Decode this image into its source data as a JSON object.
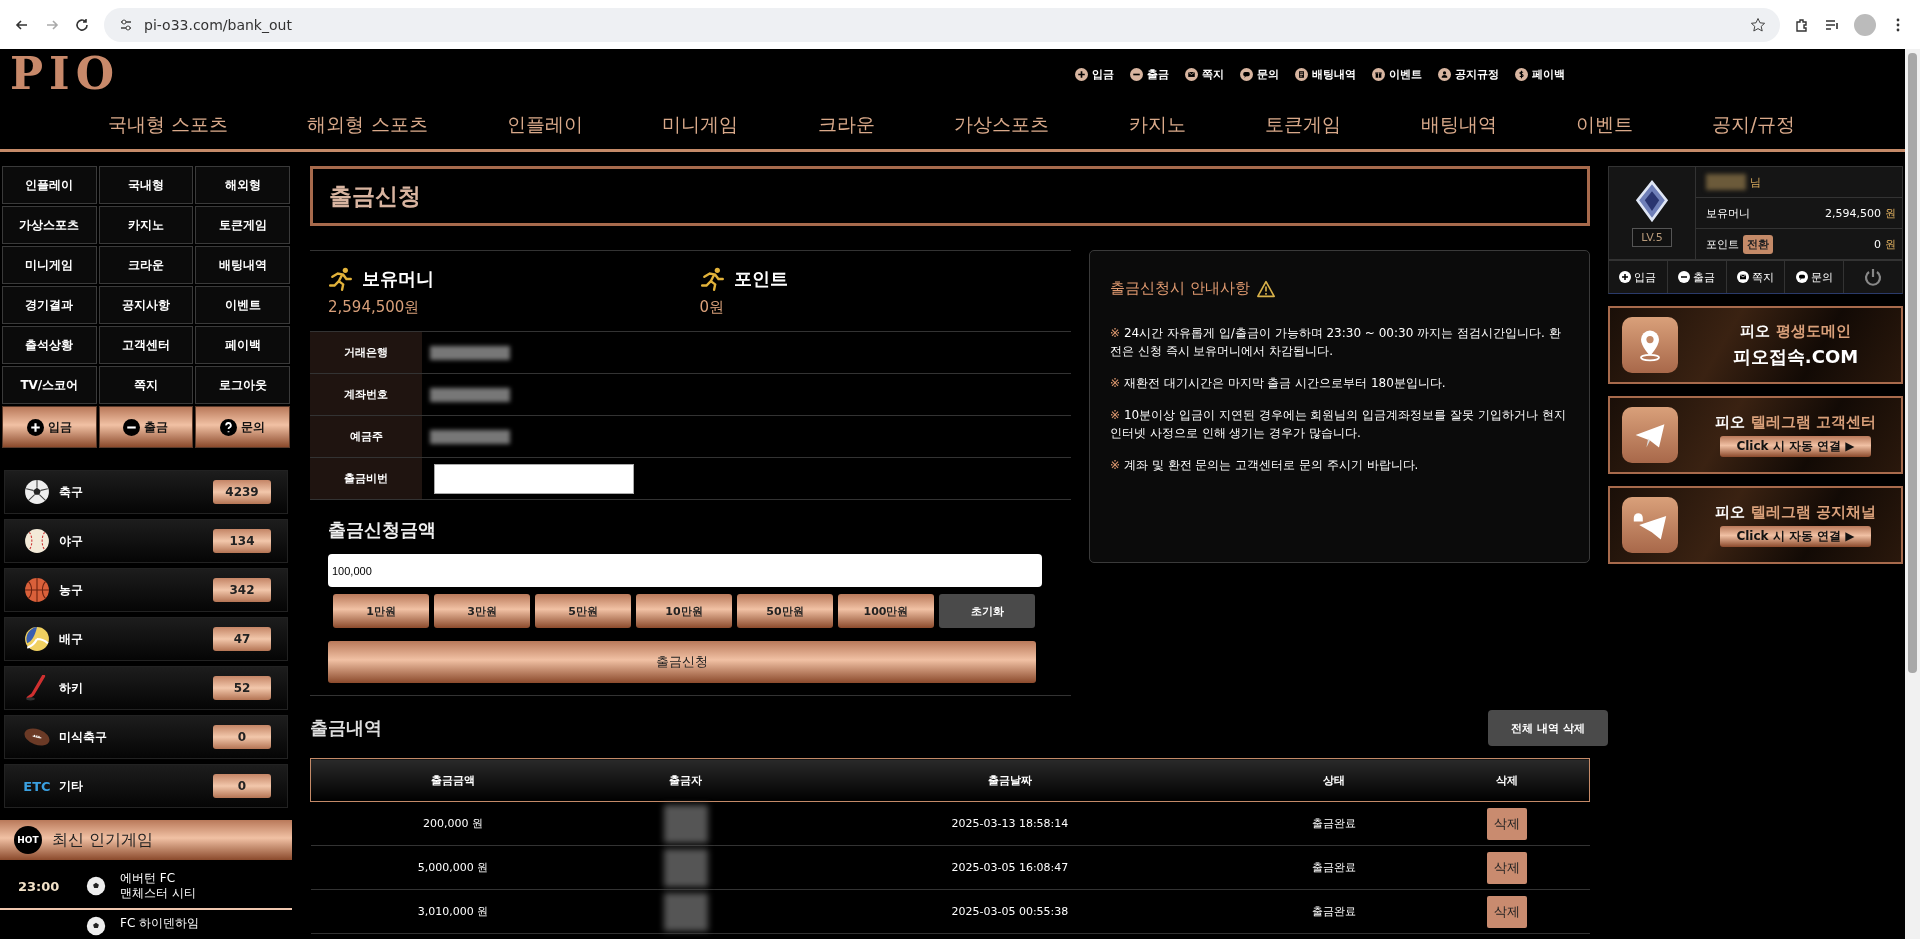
{
  "browser": {
    "url": "pi-o33.com/bank_out"
  },
  "header": {
    "logo": "PIO",
    "quick_links": [
      {
        "label": "입금",
        "kind": "plus"
      },
      {
        "label": "출금",
        "kind": "minus"
      },
      {
        "label": "쪽지",
        "kind": "mail"
      },
      {
        "label": "문의",
        "kind": "chat"
      },
      {
        "label": "배팅내역",
        "kind": "doc"
      },
      {
        "label": "이벤트",
        "kind": "gift"
      },
      {
        "label": "공지규정",
        "kind": "person"
      },
      {
        "label": "페이백",
        "kind": "dollar"
      }
    ],
    "nav": [
      "국내형 스포츠",
      "해외형 스포츠",
      "인플레이",
      "미니게임",
      "크라운",
      "가상스포츠",
      "카지노",
      "토큰게임",
      "배팅내역",
      "이벤트",
      "공지/규정"
    ]
  },
  "sidebar": {
    "menu": [
      "인플레이",
      "국내형",
      "해외형",
      "가상스포츠",
      "카지노",
      "토큰게임",
      "미니게임",
      "크라운",
      "배팅내역",
      "경기결과",
      "공지사항",
      "이벤트",
      "출석상황",
      "고객센터",
      "페이백",
      "TV/스코어",
      "쪽지",
      "로그아웃"
    ],
    "actions": [
      {
        "label": "입금",
        "kind": "plus"
      },
      {
        "label": "출금",
        "kind": "minus"
      },
      {
        "label": "문의",
        "kind": "question"
      }
    ],
    "sports": [
      {
        "name": "축구",
        "count": "4239",
        "kind": "soccer"
      },
      {
        "name": "야구",
        "count": "134",
        "kind": "baseball"
      },
      {
        "name": "농구",
        "count": "342",
        "kind": "basketball"
      },
      {
        "name": "배구",
        "count": "47",
        "kind": "volleyball"
      },
      {
        "name": "하키",
        "count": "52",
        "kind": "hockey"
      },
      {
        "name": "미식축구",
        "count": "0",
        "kind": "football"
      },
      {
        "name": "기타",
        "count": "0",
        "kind": "etc",
        "icon_text": "ETC"
      }
    ],
    "popular": {
      "badge": "HOT",
      "title": "최신 인기게임",
      "games": [
        {
          "time": "23:00",
          "teams": [
            "에버턴 FC",
            "맨체스터 시티"
          ]
        },
        {
          "teams": [
            "FC 하이덴하임"
          ]
        }
      ]
    }
  },
  "main": {
    "title": "출금신청",
    "balances": [
      {
        "label": "보유머니",
        "value": "2,594,500원"
      },
      {
        "label": "포인트",
        "value": "0원"
      }
    ],
    "account": [
      {
        "label": "거래은행",
        "kind": "masked"
      },
      {
        "label": "계좌번호",
        "kind": "masked"
      },
      {
        "label": "예금주",
        "kind": "masked"
      },
      {
        "label": "출금비번",
        "kind": "password"
      }
    ],
    "amount": {
      "label": "출금신청금액",
      "value": "100,000",
      "quick": [
        "1만원",
        "3만원",
        "5만원",
        "10만원",
        "50만원",
        "100만원"
      ],
      "reset": "초기화",
      "submit": "출금신청"
    },
    "notice": {
      "title": "출금신청시 안내사항",
      "items": [
        {
          "mark": "※",
          "text": "24시간 자유롭게 입/출금이 가능하며 23:30 ~ 00:30 까지는 점검시간입니다. 환전은 신청 즉시 보유머니에서 차감됩니다."
        },
        {
          "mark": "※",
          "text": "재환전 대기시간은 마지막 출금 시간으로부터 180분입니다."
        },
        {
          "mark": "※",
          "text": "10분이상 입금이 지연된 경우에는 회원님의 입금계좌정보를 잘못 기입하거나 현지 인터넷 사정으로 인해 생기는 경우가 많습니다."
        },
        {
          "mark": "※",
          "text": "계좌 및 환전 문의는 고객센터로 문의 주시기 바랍니다."
        }
      ]
    },
    "history": {
      "title": "출금내역",
      "delete_all": "전체 내역 삭제",
      "columns": [
        "출금금액",
        "출금자",
        "출금날짜",
        "상태",
        "삭제"
      ],
      "rows": [
        {
          "amount": "200,000 원",
          "date": "2025-03-13 18:58:14",
          "status": "출금완료",
          "action": "삭제"
        },
        {
          "amount": "5,000,000 원",
          "date": "2025-03-05 16:08:47",
          "status": "출금완료",
          "action": "삭제"
        },
        {
          "amount": "3,010,000 원",
          "date": "2025-03-05 00:55:38",
          "status": "출금완료",
          "action": "삭제"
        }
      ]
    }
  },
  "user": {
    "suffix": "님",
    "level": "LV.5",
    "stats": [
      {
        "label": "보유머니",
        "value": "2,594,500",
        "unit": "원"
      },
      {
        "label": "포인트",
        "button": "전환",
        "value": "0",
        "unit": "원"
      }
    ],
    "actions": [
      {
        "label": "입금",
        "kind": "plus"
      },
      {
        "label": "출금",
        "kind": "minus"
      },
      {
        "label": "쪽지",
        "kind": "mail"
      },
      {
        "label": "문의",
        "kind": "chat"
      },
      {
        "kind": "power"
      }
    ]
  },
  "banners": [
    {
      "kind": "pin",
      "brand": "피오",
      "title": "평생도메인",
      "subtitle": "피오접속.COM"
    },
    {
      "kind": "telegram",
      "brand": "피오",
      "title": "텔레그램 고객센터",
      "button": "Click 시 자동 연결 ▶"
    },
    {
      "kind": "telegram-bell",
      "brand": "피오",
      "title": "텔레그램 공지채널",
      "button": "Click 시 자동 연결 ▶"
    }
  ]
}
